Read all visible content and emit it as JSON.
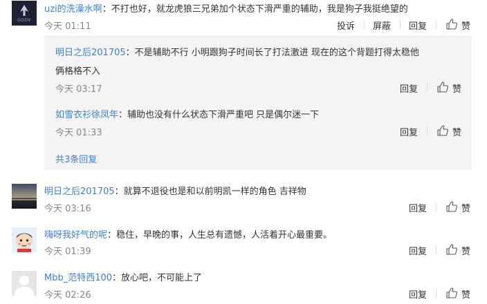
{
  "comments": [
    {
      "user": "uzi的洗澡水啊",
      "text": "：不打也好，就龙虎狼三兄弟加个状态下滑严重的辅助，我是狗子我挺绝望的",
      "time": "今天 01:11",
      "actions": {
        "report": "投诉",
        "block": "屏蔽",
        "reply": "回复",
        "like": "赞"
      },
      "avatar_text": "GODV"
    },
    {
      "user": "明日之后201705",
      "text": "：就算不退役也是和以前明凯一样的角色 吉祥物",
      "time": "今天 03:16",
      "actions": {
        "reply": "回复",
        "like": "赞"
      }
    },
    {
      "user": "嗨呀我好气的呢",
      "text": "：稳住，早晚的事，人生总有遗憾，人活着开心最重要。",
      "time": "今天 01:39",
      "actions": {
        "reply": "回复",
        "like": "赞"
      }
    },
    {
      "user": "Mbb_范特西100",
      "text": "：放心吧，不可能上了",
      "time": "今天 02:26",
      "actions": {
        "reply": "回复",
        "like": "赞"
      }
    }
  ],
  "replies": [
    {
      "user": "明日之后201705",
      "text_line1": "：不是辅助不行 小明跟狗子时间长了打法激进 现在的这个背题打得太稳他",
      "text_line2": "俩格格不入",
      "time": "今天 03:17",
      "actions": {
        "reply": "回复",
        "like": "赞"
      }
    },
    {
      "user": "如雪衣衫徐凤年",
      "text": "：辅助也没有什么状态下滑严重吧 只是偶尔迷一下",
      "time": "今天 01:33",
      "actions": {
        "reply": "回复",
        "like": "赞"
      }
    }
  ],
  "more_replies": "共3条回复",
  "colors": {
    "username": "#3a7fd5",
    "reply_bg": "#f4f4f4",
    "time": "#888888"
  }
}
